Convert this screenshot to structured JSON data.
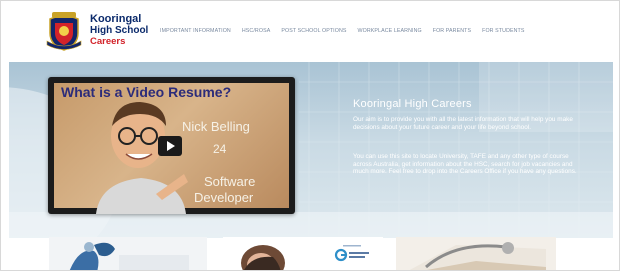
{
  "logo": {
    "line1": "Kooringal",
    "line2": "High School",
    "line3": "Careers"
  },
  "nav": {
    "items": [
      "IMPORTANT INFORMATION",
      "HSC/ROSA",
      "POST SCHOOL OPTIONS",
      "WORKPLACE LEARNING",
      "FOR PARENTS",
      "FOR STUDENTS"
    ]
  },
  "hero": {
    "title": "Kooringal High Careers",
    "paragraph1": "Our aim is to provide you with all the latest information that will help you make decisions about your future career and your life beyond school.",
    "paragraph2": "You can use this site to locate University, TAFE and any other type of course across Australia, get information about the HSC, search for job vacancies and much more. Feel free to drop into the Careers Office if you have any questions."
  },
  "video": {
    "title": "What is a Video Resume?",
    "name": "Nick Belling",
    "age": "24",
    "role_line1": "Software",
    "role_line2": "Developer",
    "play_icon": "play-icon"
  },
  "colors": {
    "brand_navy": "#0b2a6b",
    "brand_red": "#d2232a",
    "nav_text": "#7a8aa0",
    "hero_sky": "#a9c3d4"
  }
}
